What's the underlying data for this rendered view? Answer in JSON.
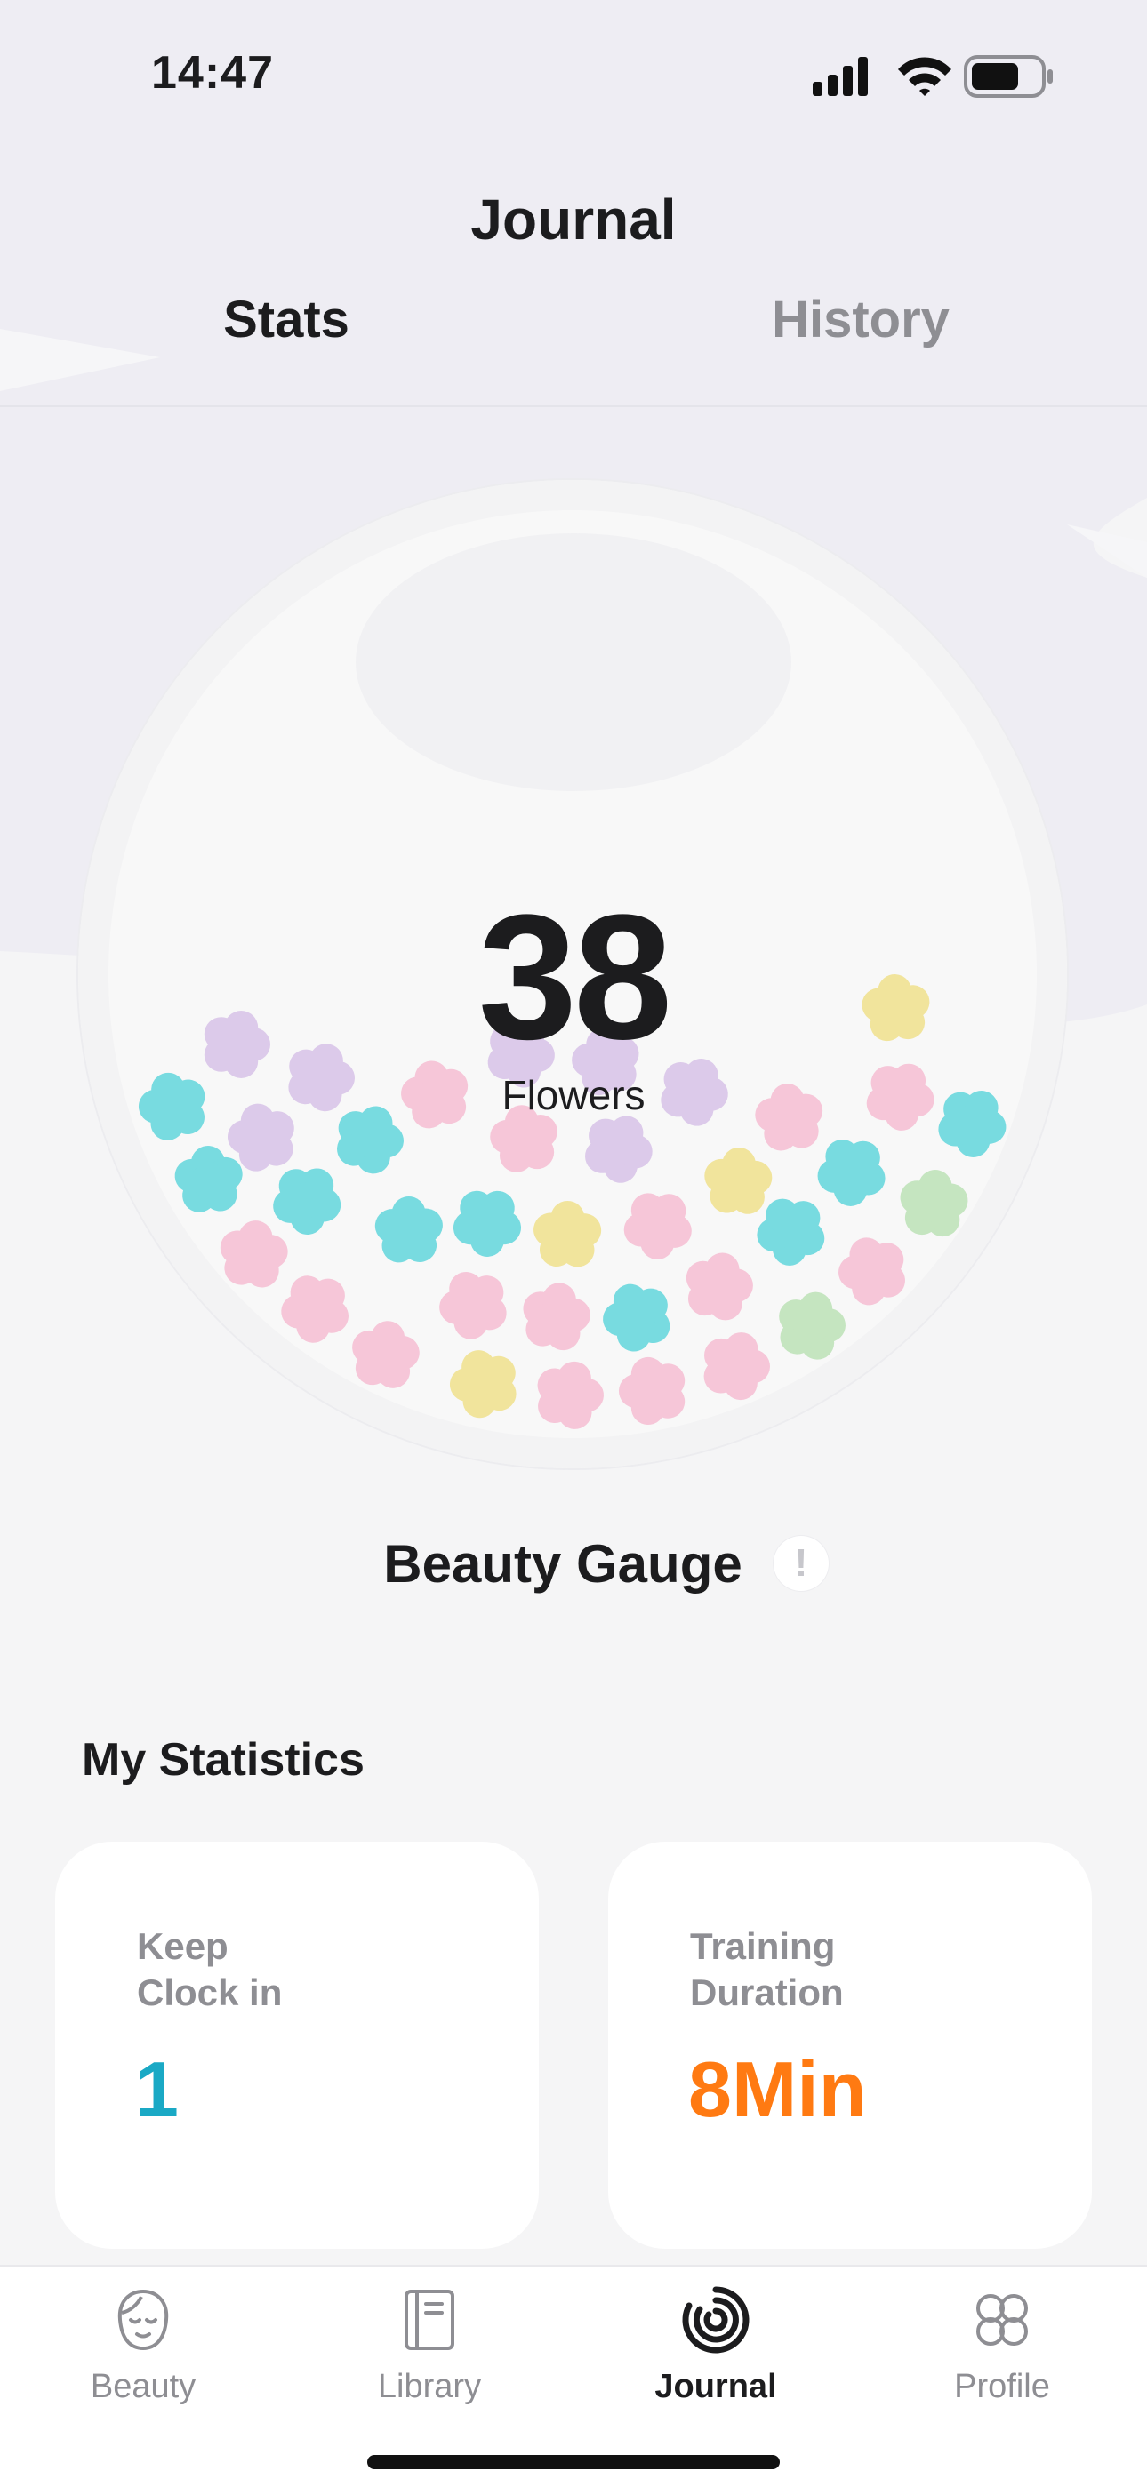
{
  "status_bar": {
    "time": "14:47",
    "icons": [
      "cellular-signal-icon",
      "wifi-icon",
      "battery-icon"
    ]
  },
  "header": {
    "title": "Journal"
  },
  "tabs": [
    {
      "label": "Stats",
      "active": true
    },
    {
      "label": "History",
      "active": false
    }
  ],
  "jar": {
    "count": "38",
    "count_label": "Flowers",
    "flower_colors": {
      "cyan": "#78dbe0",
      "pink": "#f6c6d8",
      "purple": "#dccaea",
      "yellow": "#f1e49c",
      "green": "#c5e5c0"
    }
  },
  "gauge": {
    "title": "Beauty Gauge",
    "info_icon": "!"
  },
  "statistics": {
    "title": "My Statistics",
    "cards": [
      {
        "label_line1": "Keep",
        "label_line2": "Clock in",
        "value": "1",
        "color": "#1aa9c5"
      },
      {
        "label_line1": "Training",
        "label_line2": "Duration",
        "value": "8Min",
        "color": "#ff7a12"
      }
    ]
  },
  "tab_bar": {
    "items": [
      {
        "label": "Beauty",
        "icon": "face-icon",
        "active": false
      },
      {
        "label": "Library",
        "icon": "book-icon",
        "active": false
      },
      {
        "label": "Journal",
        "icon": "journal-rings-icon",
        "active": true
      },
      {
        "label": "Profile",
        "icon": "clover-icon",
        "active": false
      }
    ]
  }
}
